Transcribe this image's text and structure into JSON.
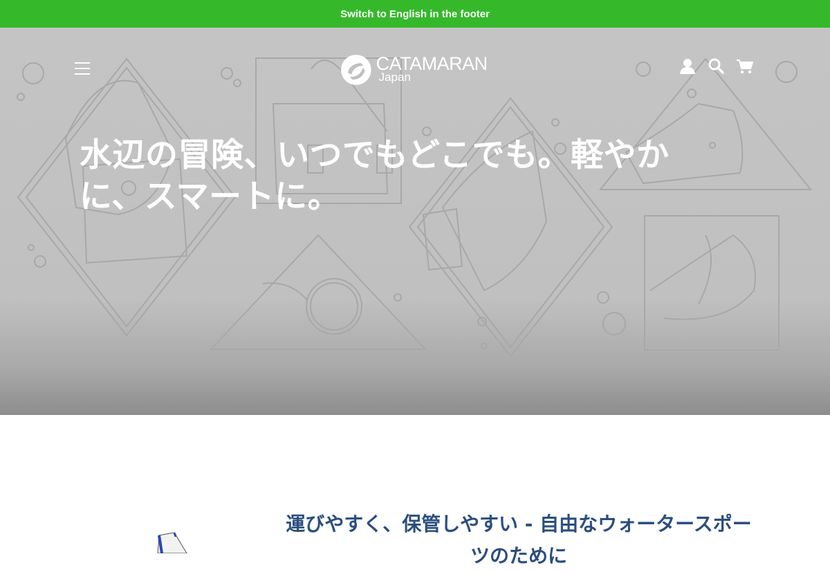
{
  "announcement": {
    "text": "Switch to English in the footer"
  },
  "header": {
    "logo": {
      "name": "CATAMARAN",
      "sub": "Japan"
    },
    "icons": {
      "menu": "menu-icon",
      "account": "account-icon",
      "search": "search-icon",
      "cart": "cart-icon"
    }
  },
  "hero": {
    "title": "水辺の冒険、いつでもどこでも。軽やかに、スマートに。"
  },
  "section": {
    "title": "運びやすく、保管しやすい - 自由なウォータースポーツのために"
  },
  "colors": {
    "announcement_bg": "#35b92b",
    "hero_bg": "#c4c4c4",
    "heading": "#2b4e7e",
    "white": "#ffffff"
  }
}
